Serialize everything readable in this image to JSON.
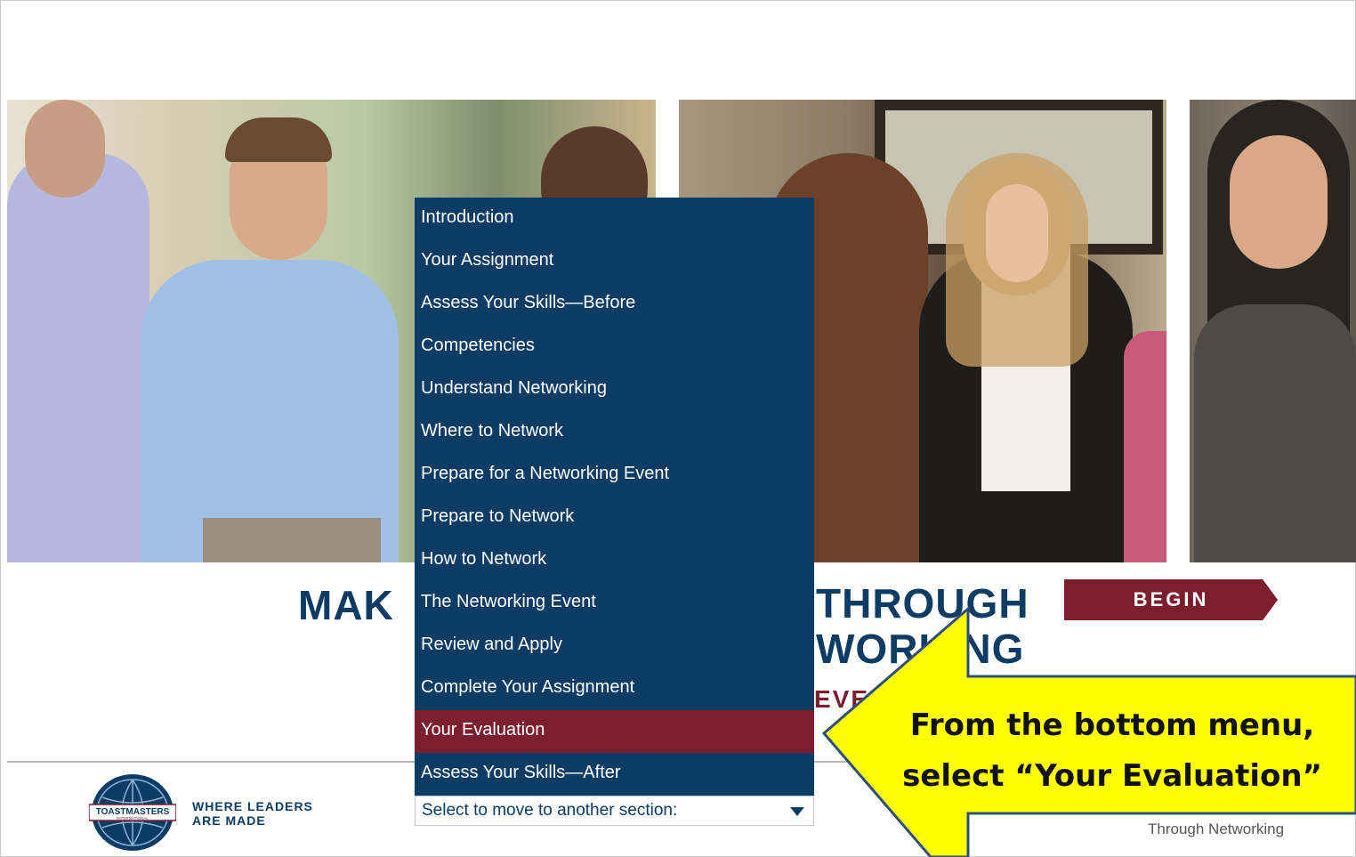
{
  "hero": {
    "title_line1_left": "MAK",
    "title_line1_right": "THROUGH",
    "title_line2_right": "WORKING",
    "subtitle_visible": "EVE",
    "begin_label": "BEGIN"
  },
  "menu": {
    "items": [
      {
        "label": "Introduction"
      },
      {
        "label": "Your Assignment"
      },
      {
        "label": "Assess Your Skills—Before"
      },
      {
        "label": "Competencies"
      },
      {
        "label": "Understand Networking"
      },
      {
        "label": "Where to Network"
      },
      {
        "label": "Prepare for a Networking Event"
      },
      {
        "label": "Prepare to Network"
      },
      {
        "label": "How to Network"
      },
      {
        "label": "The Networking Event"
      },
      {
        "label": "Review and Apply"
      },
      {
        "label": "Complete Your Assignment"
      },
      {
        "label": "Your Evaluation"
      },
      {
        "label": "Assess Your Skills—After"
      }
    ],
    "selected_index": 12,
    "select_placeholder": "Select to move to another section:"
  },
  "footer": {
    "logo_text": "TOASTMASTERS",
    "logo_subtext": "INTERNATIONAL",
    "tagline_line1": "WHERE LEADERS",
    "tagline_line2": "ARE MADE",
    "course_title_partial": "Through Networking"
  },
  "callout": {
    "line1": "From the bottom menu,",
    "line2": "select “Your Evaluation”"
  },
  "colors": {
    "navy": "#0c3b64",
    "maroon": "#7b1e2e",
    "callout_fill": "#ffff00"
  }
}
